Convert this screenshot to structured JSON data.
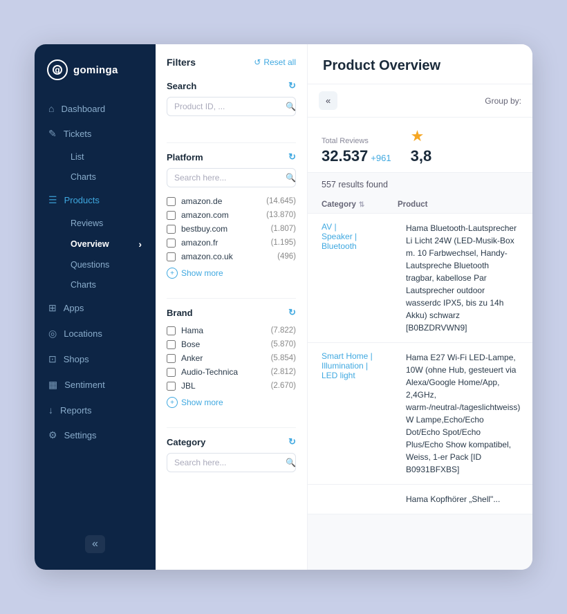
{
  "app": {
    "name": "gominga"
  },
  "sidebar": {
    "nav_items": [
      {
        "id": "dashboard",
        "label": "Dashboard",
        "icon": "⌂",
        "active": false
      },
      {
        "id": "tickets",
        "label": "Tickets",
        "icon": "✎",
        "active": false
      },
      {
        "id": "tickets-list",
        "label": "List",
        "sub": true,
        "active": false
      },
      {
        "id": "tickets-charts",
        "label": "Charts",
        "sub": true,
        "active": false
      },
      {
        "id": "products",
        "label": "Products",
        "icon": "☰",
        "active": true
      },
      {
        "id": "products-reviews",
        "label": "Reviews",
        "sub": true,
        "active": false
      },
      {
        "id": "products-overview",
        "label": "Overview",
        "sub": true,
        "active": true
      },
      {
        "id": "products-questions",
        "label": "Questions",
        "sub": true,
        "active": false
      },
      {
        "id": "products-charts",
        "label": "Charts",
        "sub": true,
        "active": false
      },
      {
        "id": "apps",
        "label": "Apps",
        "icon": "⊞",
        "active": false
      },
      {
        "id": "locations",
        "label": "Locations",
        "icon": "◎",
        "active": false
      },
      {
        "id": "shops",
        "label": "Shops",
        "icon": "⊡",
        "active": false
      },
      {
        "id": "sentiment",
        "label": "Sentiment",
        "icon": "▦",
        "active": false
      },
      {
        "id": "reports",
        "label": "Reports",
        "icon": "↓",
        "active": false
      },
      {
        "id": "settings",
        "label": "Settings",
        "icon": "⚙",
        "active": false
      }
    ],
    "collapse_label": "«"
  },
  "page": {
    "title": "Product Overview"
  },
  "filters": {
    "title": "Filters",
    "reset_label": "Reset all",
    "search_section": {
      "label": "Search",
      "placeholder": "Product ID, ..."
    },
    "platform_section": {
      "label": "Platform",
      "search_placeholder": "Search here...",
      "items": [
        {
          "name": "amazon.de",
          "count": "(14.645)"
        },
        {
          "name": "amazon.com",
          "count": "(13.870)"
        },
        {
          "name": "bestbuy.com",
          "count": "(1.807)"
        },
        {
          "name": "amazon.fr",
          "count": "(1.195)"
        },
        {
          "name": "amazon.co.uk",
          "count": "(496)"
        }
      ],
      "show_more": "Show more"
    },
    "brand_section": {
      "label": "Brand",
      "items": [
        {
          "name": "Hama",
          "count": "(7.822)"
        },
        {
          "name": "Bose",
          "count": "(5.870)"
        },
        {
          "name": "Anker",
          "count": "(5.854)"
        },
        {
          "name": "Audio-Technica",
          "count": "(2.812)"
        },
        {
          "name": "JBL",
          "count": "(2.670)"
        }
      ],
      "show_more": "Show more"
    },
    "category_section": {
      "label": "Category",
      "search_placeholder": "Search here..."
    }
  },
  "toolbar": {
    "collapse_icon": "«",
    "group_by_label": "Group by:"
  },
  "stats": {
    "total_reviews_label": "Total Reviews",
    "total_reviews_value": "32.537",
    "total_reviews_change": "+961",
    "rating_value": "3,8",
    "star_icon": "★"
  },
  "results": {
    "count_label": "557 results found"
  },
  "table": {
    "headers": [
      {
        "id": "category",
        "label": "Category"
      },
      {
        "id": "product",
        "label": "Product"
      }
    ],
    "rows": [
      {
        "category": "AV | Speaker | Bluetooth",
        "product": "Hama Bluetooth-Lautsprecher Li Licht 24W (LED-Musik-Box m. 10 Farbwechsel, Handy-Lautspreche Bluetooth tragbar, kabellose Par Lautsprecher outdoor wasserdc IPX5, bis zu 14h Akku) schwarz [B0BZDRVWN9]"
      },
      {
        "category": "Smart Home | Illumination | LED light",
        "product": "Hama E27 Wi-Fi LED-Lampe, 10W (ohne Hub, gesteuert via Alexa/Google Home/App, 2,4GHz, warm-/neutral-/tageslichtweiss) W Lampe,Echo/Echo Dot/Echo Spot/Echo Plus/Echo Show kompatibel, Weiss, 1-er Pack [ID B0931BFXBS]"
      },
      {
        "category": "",
        "product": "Hama Kopfhörer „Shell\"..."
      }
    ]
  }
}
